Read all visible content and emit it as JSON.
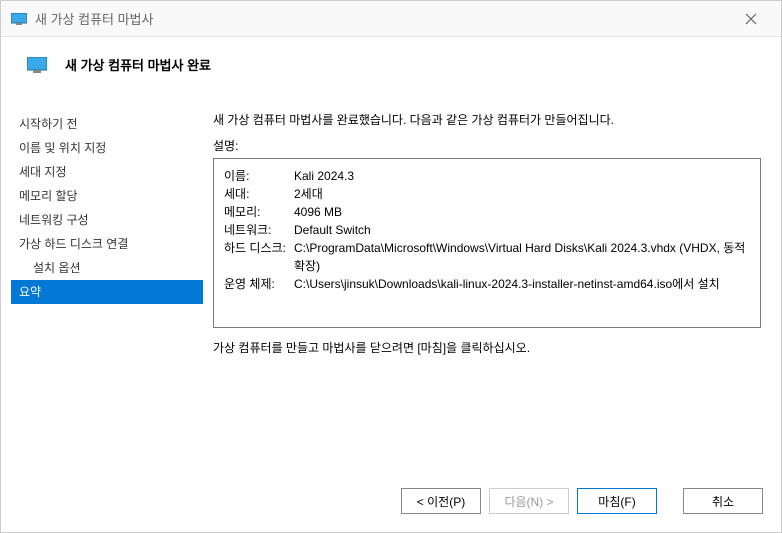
{
  "window": {
    "title": "새 가상 컴퓨터 마법사"
  },
  "header": {
    "title": "새 가상 컴퓨터 마법사 완료"
  },
  "sidebar": {
    "items": [
      {
        "label": "시작하기 전",
        "selected": false,
        "indented": false
      },
      {
        "label": "이름 및 위치 지정",
        "selected": false,
        "indented": false
      },
      {
        "label": "세대 지정",
        "selected": false,
        "indented": false
      },
      {
        "label": "메모리 할당",
        "selected": false,
        "indented": false
      },
      {
        "label": "네트워킹 구성",
        "selected": false,
        "indented": false
      },
      {
        "label": "가상 하드 디스크 연결",
        "selected": false,
        "indented": false
      },
      {
        "label": "설치 옵션",
        "selected": false,
        "indented": true
      },
      {
        "label": "요약",
        "selected": true,
        "indented": false
      }
    ]
  },
  "main": {
    "intro": "새 가상 컴퓨터 마법사를 완료했습니다. 다음과 같은 가상 컴퓨터가 만들어집니다.",
    "description_label": "설명:",
    "summary": [
      {
        "label": "이름:",
        "value": "Kali 2024.3"
      },
      {
        "label": "세대:",
        "value": "2세대"
      },
      {
        "label": "메모리:",
        "value": "4096 MB"
      },
      {
        "label": "네트워크:",
        "value": "Default Switch"
      },
      {
        "label": "하드 디스크:",
        "value": "C:\\ProgramData\\Microsoft\\Windows\\Virtual Hard Disks\\Kali 2024.3.vhdx (VHDX, 동적 확장)"
      },
      {
        "label": "운영 체제:",
        "value": "C:\\Users\\jinsuk\\Downloads\\kali-linux-2024.3-installer-netinst-amd64.iso에서 설치"
      }
    ],
    "instruction": "가상 컴퓨터를 만들고 마법사를 닫으려면 [마침]을 클릭하십시오."
  },
  "footer": {
    "previous": "< 이전(P)",
    "next": "다음(N) >",
    "finish": "마침(F)",
    "cancel": "취소"
  }
}
